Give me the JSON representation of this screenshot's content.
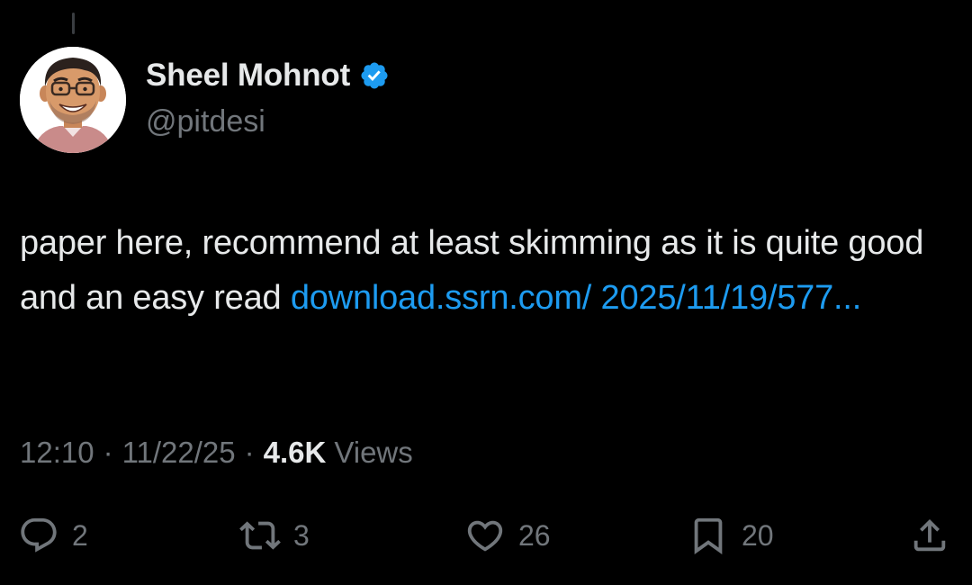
{
  "author": {
    "display_name": "Sheel Mohnot",
    "handle": "@pitdesi",
    "verified": true
  },
  "tweet": {
    "text": "paper here, recommend at least skimming as it is quite good and an easy read ",
    "link_text": "download.ssrn.com/ 2025/11/19/577..."
  },
  "meta": {
    "time": "12:10",
    "separator": "·",
    "date": "11/22/25",
    "views_count": "4.6K",
    "views_label": "Views"
  },
  "actions": {
    "reply_count": "2",
    "repost_count": "3",
    "like_count": "26",
    "bookmark_count": "20"
  },
  "colors": {
    "background": "#000000",
    "primary_text": "#e7e9ea",
    "secondary_text": "#71767b",
    "link": "#1d9bf0",
    "verified_badge": "#1d9bf0"
  },
  "icons": [
    "verified-badge-icon",
    "reply-icon",
    "repost-icon",
    "like-icon",
    "bookmark-icon",
    "share-icon"
  ]
}
